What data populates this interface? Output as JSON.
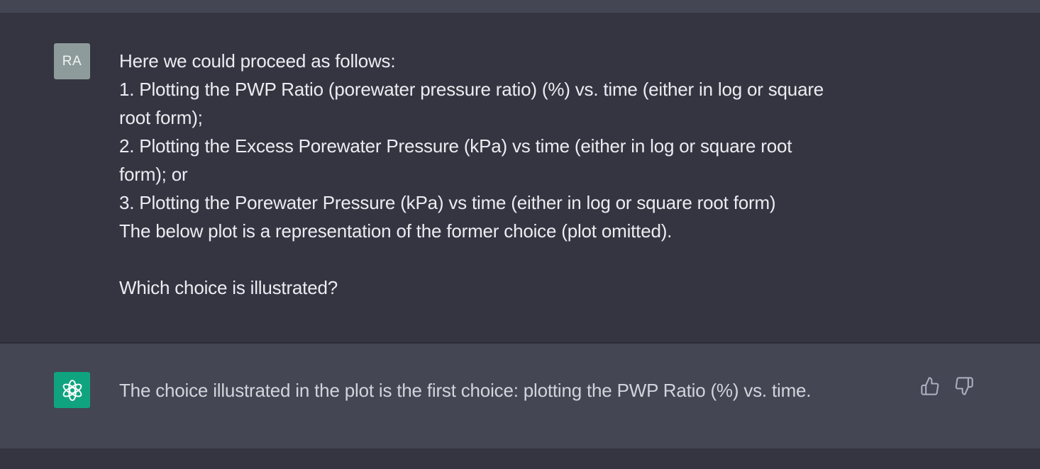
{
  "user_message": {
    "avatar_initials": "RA",
    "lines": [
      "Here we could proceed as follows:",
      "1. Plotting the PWP Ratio (porewater pressure ratio) (%) vs. time (either in log or square",
      "root form);",
      "2. Plotting the Excess Porewater Pressure (kPa) vs time (either in log or square root",
      "form); or",
      "3. Plotting the Porewater Pressure (kPa) vs time (either in log or square root form)",
      "The below plot is a representation of the former choice (plot omitted).",
      "",
      "Which choice is illustrated?"
    ]
  },
  "assistant_message": {
    "avatar_icon": "openai-logo-icon",
    "text": "The choice illustrated in the plot is the first choice: plotting the PWP Ratio (%) vs. time.",
    "feedback_icons": [
      "thumbs-up-icon",
      "thumbs-down-icon"
    ]
  },
  "colors": {
    "background": "#343541",
    "assistant_background": "#444654",
    "user_avatar": "#8e9b9b",
    "assistant_avatar": "#10a37f",
    "user_text": "#ececf1",
    "assistant_text": "#d1d5db"
  }
}
